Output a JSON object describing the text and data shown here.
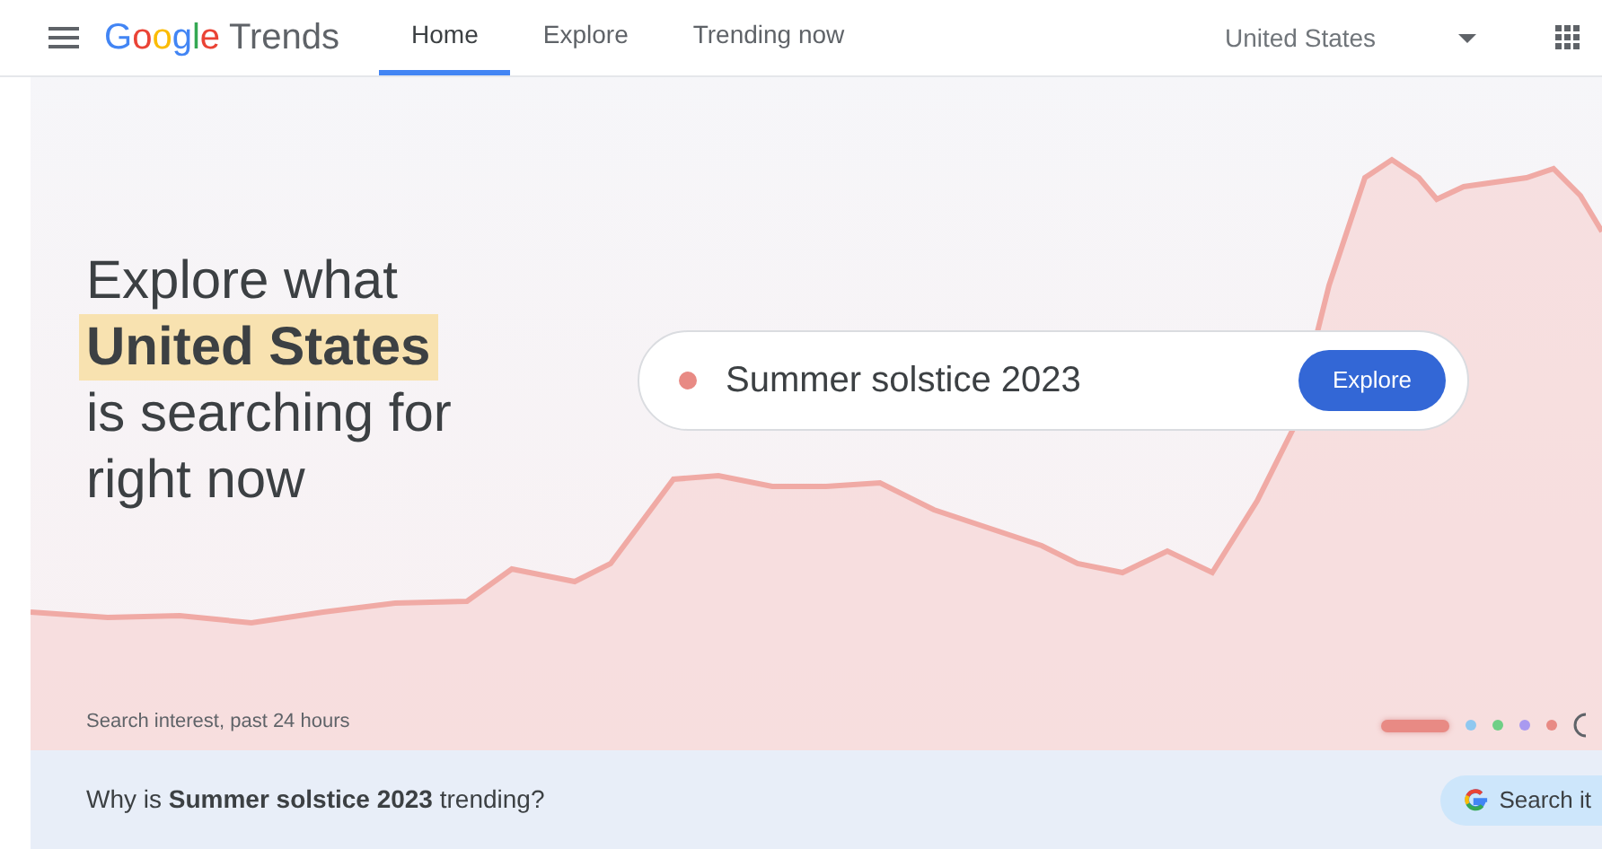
{
  "header": {
    "logo": {
      "brand": "Google",
      "product": "Trends"
    },
    "tabs": [
      {
        "label": "Home",
        "selected": true
      },
      {
        "label": "Explore",
        "selected": false
      },
      {
        "label": "Trending now",
        "selected": false
      }
    ],
    "region": "United States"
  },
  "hero": {
    "title_lines": [
      {
        "text": "Explore what",
        "kind": "plain"
      },
      {
        "text": "United States",
        "kind": "highlight"
      },
      {
        "text": "is searching for",
        "kind": "plain"
      },
      {
        "text": "right now",
        "kind": "plain"
      }
    ],
    "search": {
      "value": "Summer solstice 2023",
      "button": "Explore"
    },
    "chart_caption": "Search interest, past 24 hours",
    "carousel": [
      {
        "color": "#e88a84",
        "selected": true
      },
      {
        "color": "#8fc8f0",
        "selected": false
      },
      {
        "color": "#6fcf86",
        "selected": false
      },
      {
        "color": "#a99af0",
        "selected": false
      },
      {
        "color": "#e88a84",
        "selected": false
      }
    ]
  },
  "trending_bar": {
    "text": "Why is **Summer solstice 2023** trending?",
    "button": "Search it"
  }
}
